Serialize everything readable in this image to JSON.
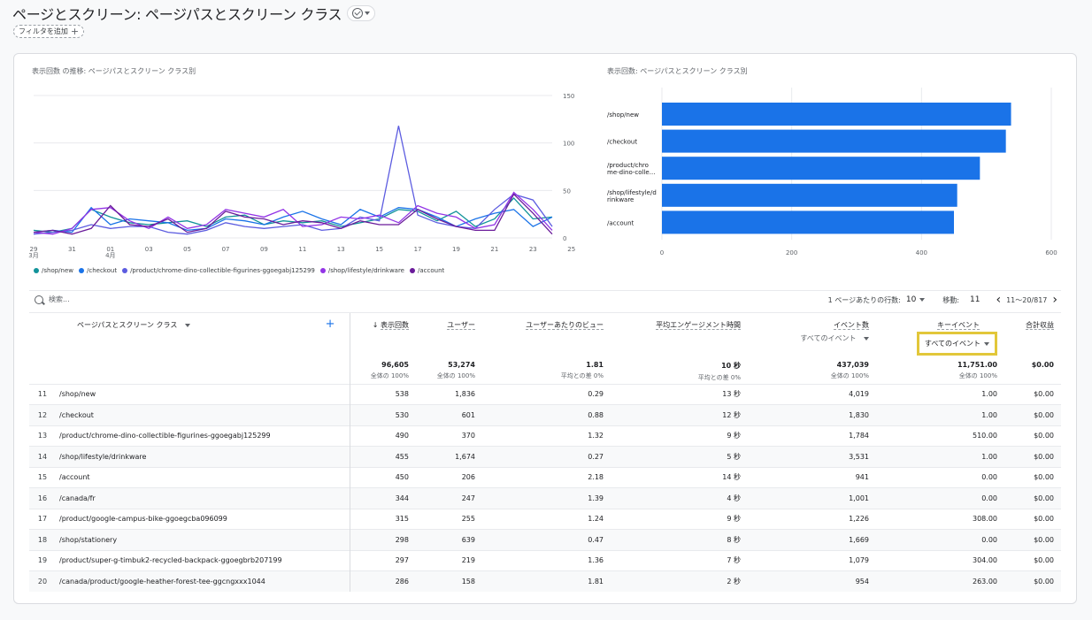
{
  "header": {
    "title": "ページとスクリーン: ページパスとスクリーン クラス",
    "add_filter": "フィルタを追加"
  },
  "line_chart": {
    "title": "表示回数 の推移: ページパスとスクリーン クラス別",
    "y_ticks": [
      "150",
      "100",
      "50",
      "0"
    ],
    "x_ticks": [
      {
        "label": "29",
        "sub": "3月"
      },
      {
        "label": "31",
        "sub": ""
      },
      {
        "label": "01",
        "sub": "4月"
      },
      {
        "label": "03",
        "sub": ""
      },
      {
        "label": "05",
        "sub": ""
      },
      {
        "label": "07",
        "sub": ""
      },
      {
        "label": "09",
        "sub": ""
      },
      {
        "label": "11",
        "sub": ""
      },
      {
        "label": "13",
        "sub": ""
      },
      {
        "label": "15",
        "sub": ""
      },
      {
        "label": "17",
        "sub": ""
      },
      {
        "label": "19",
        "sub": ""
      },
      {
        "label": "21",
        "sub": ""
      },
      {
        "label": "23",
        "sub": ""
      },
      {
        "label": "25",
        "sub": ""
      }
    ]
  },
  "chart_data": [
    {
      "type": "line",
      "title": "表示回数 の推移: ページパスとスクリーン クラス別",
      "ylim": [
        0,
        150
      ],
      "x": [
        "3/29",
        "3/30",
        "3/31",
        "4/01",
        "4/02",
        "4/03",
        "4/04",
        "4/05",
        "4/06",
        "4/07",
        "4/08",
        "4/09",
        "4/10",
        "4/11",
        "4/12",
        "4/13",
        "4/14",
        "4/15",
        "4/16",
        "4/17",
        "4/18",
        "4/19",
        "4/20",
        "4/21",
        "4/22",
        "4/23",
        "4/24",
        "4/25"
      ],
      "series": [
        {
          "name": "/shop/new",
          "color": "#12939a",
          "values": [
            8,
            6,
            10,
            30,
            22,
            16,
            14,
            16,
            18,
            12,
            22,
            24,
            14,
            18,
            16,
            18,
            12,
            16,
            20,
            30,
            28,
            18,
            28,
            12,
            20,
            42,
            20,
            22
          ]
        },
        {
          "name": "/checkout",
          "color": "#1a73e8",
          "values": [
            6,
            8,
            6,
            32,
            14,
            20,
            18,
            16,
            8,
            10,
            20,
            18,
            14,
            22,
            28,
            20,
            14,
            30,
            22,
            32,
            30,
            22,
            12,
            20,
            26,
            30,
            12,
            22
          ]
        },
        {
          "name": "/product/chrome-dino-collectible-figurines-ggoegabj125299",
          "color": "#5c5ce0",
          "values": [
            4,
            6,
            8,
            14,
            10,
            12,
            12,
            6,
            4,
            8,
            16,
            12,
            10,
            12,
            14,
            8,
            10,
            22,
            18,
            118,
            24,
            16,
            12,
            10,
            30,
            46,
            40,
            12
          ]
        },
        {
          "name": "/shop/lifestyle/drinkware",
          "color": "#9334e6",
          "values": [
            6,
            4,
            10,
            30,
            32,
            18,
            10,
            22,
            10,
            14,
            30,
            26,
            22,
            30,
            12,
            14,
            22,
            20,
            24,
            16,
            34,
            26,
            22,
            10,
            14,
            48,
            30,
            8
          ]
        },
        {
          "name": "/account",
          "color": "#6a1b9a",
          "values": [
            6,
            8,
            4,
            10,
            34,
            14,
            12,
            20,
            6,
            10,
            28,
            22,
            20,
            14,
            18,
            16,
            10,
            18,
            14,
            14,
            30,
            20,
            12,
            8,
            8,
            46,
            26,
            4
          ]
        }
      ]
    },
    {
      "type": "bar",
      "orientation": "horizontal",
      "title": "表示回数: ページパスとスクリーン クラス別",
      "categories": [
        "/shop/new",
        "/checkout",
        "/product/chrome-dino-collectible-figurines-ggoegabj125299",
        "/shop/lifestyle/drinkware",
        "/account"
      ],
      "category_labels": [
        [
          "/shop/new"
        ],
        [
          "/checkout"
        ],
        [
          "/product/chro",
          "me-dino-colle..."
        ],
        [
          "/shop/lifestyle/d",
          "rinkware"
        ],
        [
          "/account"
        ]
      ],
      "values": [
        538,
        530,
        490,
        455,
        450
      ],
      "xlim": [
        0,
        600
      ],
      "x_ticks": [
        "0",
        "200",
        "400",
        "600"
      ],
      "color": "#1a73e8"
    }
  ],
  "bar_chart": {
    "title": "表示回数: ページパスとスクリーン クラス別"
  },
  "toolbar": {
    "search_placeholder": "検索...",
    "rows_per_page_label": "1 ページあたりの行数:",
    "rows_per_page": "10",
    "goto_label": "移動:",
    "goto_value": "11",
    "range": "11～20/817"
  },
  "table": {
    "columns": {
      "dim": "ページパスとスクリーン クラス",
      "views": "表示回数",
      "users": "ユーザー",
      "views_per_user": "ユーザーあたりのビュー",
      "avg_engagement": "平均エンゲージメント時間",
      "events": "イベント数",
      "events_filter": "すべてのイベント",
      "key_events": "キーイベント",
      "key_events_filter": "すべてのイベント",
      "revenue": "合計収益"
    },
    "totals": {
      "views": "96,605",
      "views_pct": "全体の 100%",
      "users": "53,274",
      "users_pct": "全体の 100%",
      "vpu": "1.81",
      "vpu_pct": "平均との差 0%",
      "eng": "10 秒",
      "eng_pct": "平均との差 0%",
      "events": "437,039",
      "events_pct": "全体の 100%",
      "key": "11,751.00",
      "key_pct": "全体の 100%",
      "rev": "$0.00"
    },
    "rows": [
      {
        "idx": "11",
        "path": "/shop/new",
        "views": "538",
        "users": "1,836",
        "vpu": "0.29",
        "eng": "13 秒",
        "events": "4,019",
        "key": "1.00",
        "rev": "$0.00"
      },
      {
        "idx": "12",
        "path": "/checkout",
        "views": "530",
        "users": "601",
        "vpu": "0.88",
        "eng": "12 秒",
        "events": "1,830",
        "key": "1.00",
        "rev": "$0.00"
      },
      {
        "idx": "13",
        "path": "/product/chrome-dino-collectible-figurines-ggoegabj125299",
        "views": "490",
        "users": "370",
        "vpu": "1.32",
        "eng": "9 秒",
        "events": "1,784",
        "key": "510.00",
        "rev": "$0.00"
      },
      {
        "idx": "14",
        "path": "/shop/lifestyle/drinkware",
        "views": "455",
        "users": "1,674",
        "vpu": "0.27",
        "eng": "5 秒",
        "events": "3,531",
        "key": "1.00",
        "rev": "$0.00"
      },
      {
        "idx": "15",
        "path": "/account",
        "views": "450",
        "users": "206",
        "vpu": "2.18",
        "eng": "14 秒",
        "events": "941",
        "key": "0.00",
        "rev": "$0.00"
      },
      {
        "idx": "16",
        "path": "/canada/fr",
        "views": "344",
        "users": "247",
        "vpu": "1.39",
        "eng": "4 秒",
        "events": "1,001",
        "key": "0.00",
        "rev": "$0.00"
      },
      {
        "idx": "17",
        "path": "/product/google-campus-bike-ggoegcba096099",
        "views": "315",
        "users": "255",
        "vpu": "1.24",
        "eng": "9 秒",
        "events": "1,226",
        "key": "308.00",
        "rev": "$0.00"
      },
      {
        "idx": "18",
        "path": "/shop/stationery",
        "views": "298",
        "users": "639",
        "vpu": "0.47",
        "eng": "8 秒",
        "events": "1,669",
        "key": "0.00",
        "rev": "$0.00"
      },
      {
        "idx": "19",
        "path": "/product/super-g-timbuk2-recycled-backpack-ggoegbrb207199",
        "views": "297",
        "users": "219",
        "vpu": "1.36",
        "eng": "7 秒",
        "events": "1,079",
        "key": "304.00",
        "rev": "$0.00"
      },
      {
        "idx": "20",
        "path": "/canada/product/google-heather-forest-tee-ggcngxxx1044",
        "views": "286",
        "users": "158",
        "vpu": "1.81",
        "eng": "2 秒",
        "events": "954",
        "key": "263.00",
        "rev": "$0.00"
      }
    ]
  }
}
